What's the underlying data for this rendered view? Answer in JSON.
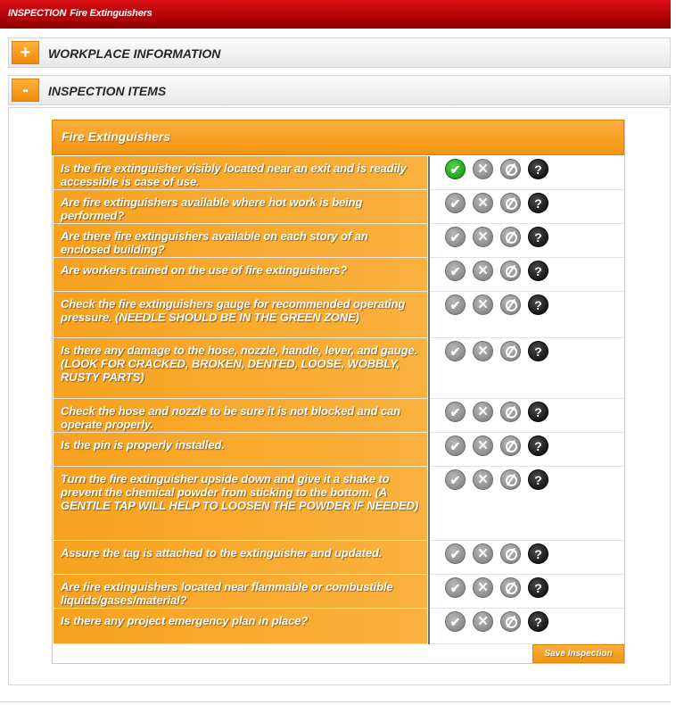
{
  "header": {
    "section": "INSPECTION",
    "title": "Fire Extinguishers"
  },
  "sections": {
    "workplace": {
      "toggle": "+",
      "label": "WORKPLACE INFORMATION"
    },
    "inspection": {
      "toggle": "-",
      "label": "INSPECTION ITEMS"
    }
  },
  "table": {
    "heading": "Fire Extinguishers",
    "items": [
      {
        "question": "Is the fire extinguisher visibly located near an exit and is readily accessible is case of use.",
        "answer": "yes"
      },
      {
        "question": "Are fire extinguishers available where hot work is being performed?",
        "answer": ""
      },
      {
        "question": "Are there fire extinguishers available on each story of an enclosed building?",
        "answer": ""
      },
      {
        "question": "Are workers trained on the use of fire extinguishers?",
        "answer": ""
      },
      {
        "question": "Check the fire extinguishers gauge for recommended operating pressure. (NEEDLE SHOULD BE IN THE GREEN ZONE)",
        "answer": ""
      },
      {
        "question": "Is there any damage to the hose, nozzle, handle, lever, and gauge. (LOOK FOR CRACKED, BROKEN, DENTED, LOOSE, WOBBLY, RUSTY PARTS)",
        "answer": ""
      },
      {
        "question": "Check the hose and nozzle to be sure it is not blocked and can operate properly.",
        "answer": ""
      },
      {
        "question": "Is the pin is properly installed.",
        "answer": ""
      },
      {
        "question": "Turn the fire extinguisher upside down and give it a shake to prevent the chemical powder from sticking to the bottom. (A GENTILE TAP WILL HELP TO LOOSEN THE POWDER IF NEEDED)",
        "answer": ""
      },
      {
        "question": "Assure the tag is attached to the extinguisher and updated.",
        "answer": ""
      },
      {
        "question": "Are fire extinguishers located near flammable or combustible liquids/gases/material?",
        "answer": ""
      },
      {
        "question": "Is there any project emergency plan in place?",
        "answer": ""
      }
    ]
  },
  "icons": {
    "yes": "check-icon",
    "no": "x-icon",
    "na": "not-applicable-icon",
    "help": "question-icon",
    "yes_glyph": "✔",
    "no_glyph": "✕",
    "help_glyph": "?"
  },
  "save_label": "Save Inspection",
  "colors": {
    "header_red": "#c4070d",
    "accent_orange": "#f7a21f",
    "checked_green": "#1ea11b"
  }
}
